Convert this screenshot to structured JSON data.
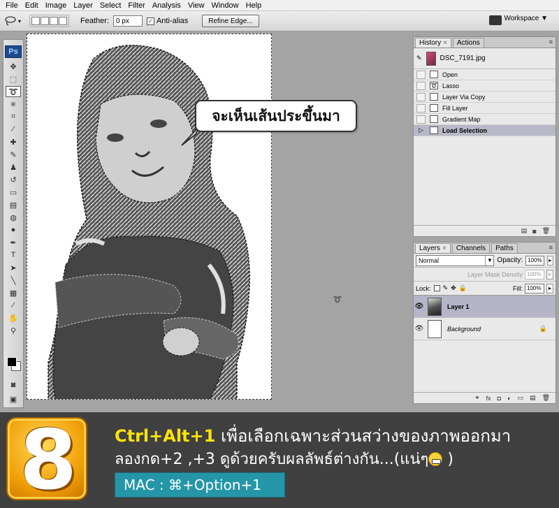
{
  "menu": [
    "File",
    "Edit",
    "Image",
    "Layer",
    "Select",
    "Filter",
    "Analysis",
    "View",
    "Window",
    "Help"
  ],
  "options": {
    "feather_label": "Feather:",
    "feather_value": "0 px",
    "antialias_label": "Anti-alias",
    "refine_label": "Refine Edge...",
    "workspace_label": "Workspace ▼"
  },
  "toolbar": {
    "logo": "Ps"
  },
  "bubble": {
    "text": "จะเห็นเส้นประขึ้นมา"
  },
  "history": {
    "tab_history": "History",
    "tab_actions": "Actions",
    "source": "DSC_7191.jpg",
    "steps": [
      "Open",
      "Lasso",
      "Layer Via Copy",
      "Fill Layer",
      "Gradient Map",
      "Load Selection"
    ]
  },
  "layers": {
    "tab_layers": "Layers",
    "tab_channels": "Channels",
    "tab_paths": "Paths",
    "blend_mode": "Normal",
    "opacity_label": "Opacity:",
    "opacity_value": "100%",
    "mask_density_label": "Layer Mask Density",
    "mask_density_value": "100%",
    "lock_label": "Lock:",
    "fill_label": "Fill:",
    "fill_value": "100%",
    "items": [
      {
        "name": "Layer 1"
      },
      {
        "name": "Background"
      }
    ]
  },
  "banner": {
    "step_number": "8",
    "shortcut": "Ctrl+Alt+1",
    "line1_rest": " เพื่อเลือกเฉพาะส่วนสว่างของภาพออกมา",
    "line2_a": "ลองกด+2 ,+3 ดูด้วยครับผลลัพธ์ต่างกัน...(แน่ๆ",
    "line2_b": " )",
    "mac_label": "MAC :  ⌘+Option+1"
  },
  "colors": {
    "ps_blue": "#1c4a92",
    "active_row": "#b8b8c8",
    "banner_bg": "#404040",
    "badge_orange": "#f2a007",
    "shortcut_yellow": "#ffe400",
    "mac_teal": "#2596a8"
  }
}
